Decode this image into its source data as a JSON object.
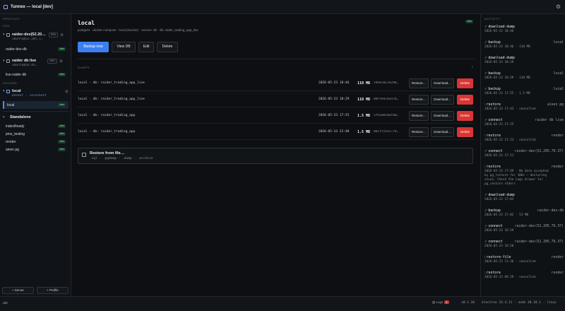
{
  "window": {
    "title": "Tunnex — local [dev]",
    "settings_icon": "gear-icon"
  },
  "sidebar": {
    "profiles_label": "PROFILES",
    "ssh_label": "SSH",
    "docker_label": "DOCKER",
    "servers": [
      {
        "name": "raider-dev(52.20…",
        "sub": "ubuntu@52.205.7…",
        "chip": "SSH",
        "count": "1",
        "dbs": [
          {
            "name": "raider-dev-db",
            "tag": "dev"
          }
        ]
      },
      {
        "name": "raider db live",
        "sub": "ubuntu@54.45…",
        "chip": "SSH",
        "count": "1",
        "dbs": [
          {
            "name": "live-raider-db",
            "tag": "dev"
          }
        ]
      },
      {
        "name": "local",
        "sub": "Docker · localhost",
        "count": "1",
        "dbs": [
          {
            "name": "local",
            "tag": "dev"
          }
        ]
      }
    ],
    "standalone": {
      "label": "Standalone",
      "items": [
        {
          "name": "indexReady",
          "tag": "dev"
        },
        {
          "name": "pms_testing",
          "tag": "dev"
        },
        {
          "name": "render",
          "tag": "dev"
        },
        {
          "name": "aiven pg",
          "tag": "dev"
        }
      ]
    },
    "add_server": "+ Server",
    "add_profile": "+ Profile"
  },
  "main": {
    "title": "local",
    "breadcrumb": "postgres · docker-compose · local (Docker) · service: db · db: raider_trading_app_live",
    "badge": "dev",
    "actions": {
      "backup": "Backup now",
      "view_db": "View DB",
      "edit": "Edit",
      "delete": "Delete"
    },
    "dumps_label": "DUMPS",
    "row_actions": {
      "restore": "Restore…",
      "download": "Download…",
      "delete": "Delete"
    },
    "dumps": [
      {
        "name": "local · db: raider_trading_app_live",
        "date": "2026-05-23 18:46",
        "size": "110 MB",
        "hash": "59e0701242d8…"
      },
      {
        "name": "local · db: raider_trading_app_live",
        "date": "2026-05-23 18:29",
        "size": "110 MB",
        "hash": "00f59424a47b…"
      },
      {
        "name": "local · db: raider_trading_app",
        "date": "2026-05-23 17:55",
        "size": "1.5 MB",
        "hash": "5fd18010afb0…"
      },
      {
        "name": "local · db: raider_trading_app",
        "date": "2026-05-14 22:48",
        "size": "1.5 MB",
        "hash": "001fc55ec779…"
      }
    ],
    "restore_file": {
      "title": "Restore from file…",
      "types": ".sql · .pgdump · .dump · .archive"
    }
  },
  "activity": {
    "label": "ACTIVITY",
    "events": [
      {
        "status": "ok",
        "action": "download-dump",
        "target": "",
        "detail": "2026-05-23 18:46"
      },
      {
        "status": "ok",
        "action": "backup",
        "target": "local",
        "detail": "2026-05-23 18:46 · 110 MB"
      },
      {
        "status": "ok",
        "action": "download-dump",
        "target": "",
        "detail": "2026-05-23 18:29"
      },
      {
        "status": "ok",
        "action": "backup",
        "target": "local",
        "detail": "2026-05-23 18:29 · 110 MB"
      },
      {
        "status": "ok",
        "action": "backup",
        "target": "local",
        "detail": "2026-05-23 17:55 · 1.5 MB"
      },
      {
        "status": "bad",
        "action": "restore",
        "target": "aiven pg",
        "detail": "2026-05-23 17:43 · cancelled"
      },
      {
        "status": "ok",
        "action": "connect",
        "target": "raider db live",
        "detail": "2026-05-23 17:25"
      },
      {
        "status": "bad",
        "action": "restore",
        "target": "render",
        "detail": "2026-05-23 17:23 · cancelled"
      },
      {
        "status": "ok",
        "action": "connect",
        "target": "raider-dev(52.205.79.37)",
        "detail": "2026-05-23 17:11"
      },
      {
        "status": "bad",
        "action": "restore",
        "target": "render",
        "detail": "2026-05-23 17:09 · No data accepted\nby pg_restore for 300s — declaring\nstuck. Check the Logs drawer for\npg_restore stderr."
      },
      {
        "status": "ok",
        "action": "download-dump",
        "target": "",
        "detail": "2026-05-23 17:02"
      },
      {
        "status": "ok",
        "action": "backup",
        "target": "raider-dev-db",
        "detail": "2026-05-23 17:02 · 53 MB"
      },
      {
        "status": "ok",
        "action": "connect",
        "target": "raider-dev(52.205.79.37)",
        "detail": "2026-05-23 16:59"
      },
      {
        "status": "ok",
        "action": "connect",
        "target": "raider-dev(52.205.79.37)",
        "detail": "2026-05-23 16:58"
      },
      {
        "status": "bad",
        "action": "restore-file",
        "target": "render",
        "detail": "2026-05-23 11:36 · cancelled"
      },
      {
        "status": "bad",
        "action": "restore",
        "target": "render",
        "detail": "2026-05-23 09:29 · cancelled"
      }
    ]
  },
  "statusbar": {
    "idle": "idle",
    "logs_label": "Logs",
    "logs_count": "2",
    "version": "v0.1.10",
    "env": "electron 33.4.11 · node 20.18.1 · linux"
  }
}
